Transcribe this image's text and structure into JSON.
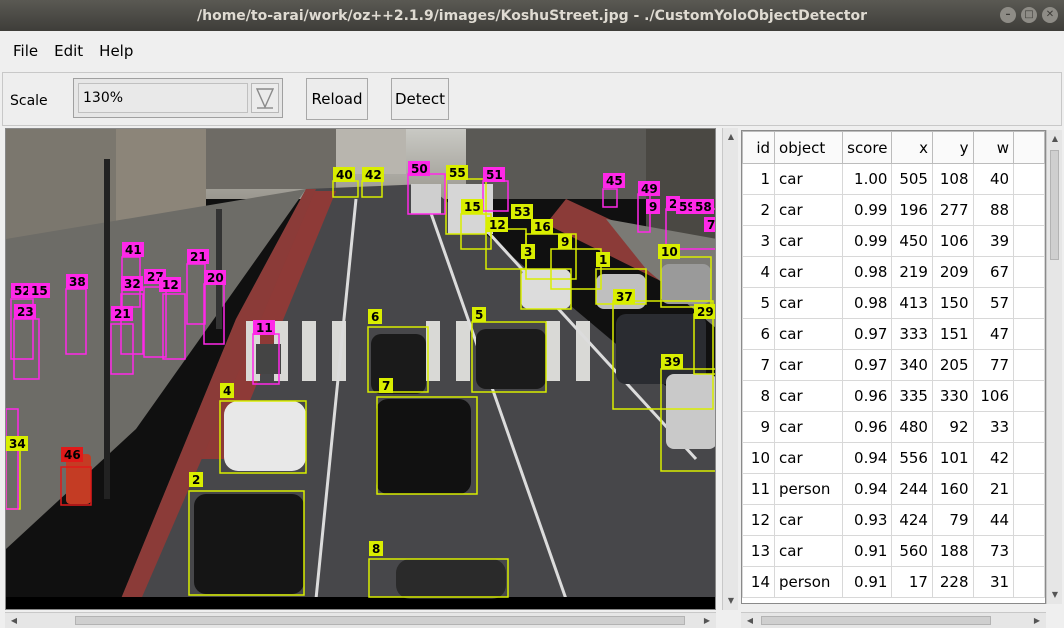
{
  "window": {
    "title": "/home/to-arai/work/oz++2.1.9/images/KoshuStreet.jpg - ./CustomYoloObjectDetector"
  },
  "menu": {
    "items": [
      "File",
      "Edit",
      "Help"
    ]
  },
  "toolbar": {
    "scale_label": "Scale",
    "scale_value": "130%",
    "reload_label": "Reload",
    "detect_label": "Detect"
  },
  "detections_table": {
    "columns": [
      "id",
      "object",
      "score",
      "x",
      "y",
      "w"
    ],
    "rows": [
      [
        "1",
        "car",
        "1.00",
        "505",
        "108",
        "40"
      ],
      [
        "2",
        "car",
        "0.99",
        "196",
        "277",
        "88"
      ],
      [
        "3",
        "car",
        "0.99",
        "450",
        "106",
        "39"
      ],
      [
        "4",
        "car",
        "0.98",
        "219",
        "209",
        "67"
      ],
      [
        "5",
        "car",
        "0.98",
        "413",
        "150",
        "57"
      ],
      [
        "6",
        "car",
        "0.97",
        "333",
        "151",
        "47"
      ],
      [
        "7",
        "car",
        "0.97",
        "340",
        "205",
        "77"
      ],
      [
        "8",
        "car",
        "0.96",
        "335",
        "330",
        "106"
      ],
      [
        "9",
        "car",
        "0.96",
        "480",
        "92",
        "33"
      ],
      [
        "10",
        "car",
        "0.94",
        "556",
        "101",
        "42"
      ],
      [
        "11",
        "person",
        "0.94",
        "244",
        "160",
        "21"
      ],
      [
        "12",
        "car",
        "0.93",
        "424",
        "79",
        "44"
      ],
      [
        "13",
        "car",
        "0.91",
        "560",
        "188",
        "73"
      ],
      [
        "14",
        "person",
        "0.91",
        "17",
        "228",
        "31"
      ]
    ]
  },
  "image_labels": {
    "yellow": [
      "40",
      "42",
      "55",
      "15",
      "12",
      "53",
      "16",
      "9",
      "3",
      "1",
      "10",
      "37",
      "29",
      "39",
      "6",
      "5",
      "4",
      "7",
      "2",
      "8",
      "34"
    ],
    "magenta": [
      "50",
      "51",
      "45",
      "49",
      "2",
      "9",
      "59",
      "58",
      "7",
      "41",
      "21",
      "27",
      "32",
      "12",
      "20",
      "38",
      "52",
      "15",
      "23",
      "21",
      "11"
    ],
    "red": [
      "46"
    ]
  }
}
